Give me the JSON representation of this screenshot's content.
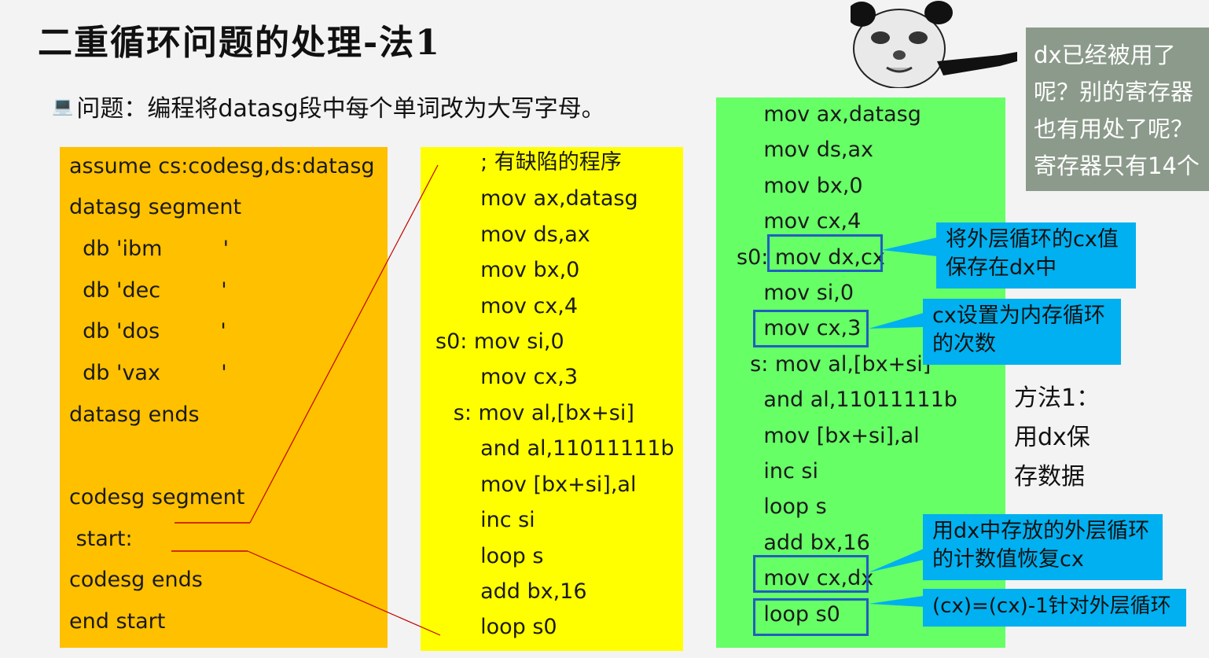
{
  "title": "二重循环问题的处理-法1",
  "problem": {
    "icon": "computer-icon",
    "text": "问题：编程将datasg段中每个单词改为大写字母。"
  },
  "orange_code": [
    "assume cs:codesg,ds:datasg",
    "datasg segment",
    "  db 'ibm         '",
    "  db 'dec         '",
    "  db 'dos         '",
    "  db 'vax         '",
    "datasg ends",
    "",
    "codesg segment",
    " start: ",
    "codesg ends",
    "end start"
  ],
  "yellow_code": [
    "       ; 有缺陷的程序",
    "       mov ax,datasg",
    "       mov ds,ax",
    "       mov bx,0",
    "       mov cx,4",
    "s0: mov si,0",
    "       mov cx,3",
    "   s: mov al,[bx+si]",
    "       and al,11011111b",
    "       mov [bx+si],al",
    "       inc si",
    "       loop s",
    "       add bx,16",
    "       loop s0"
  ],
  "green_code": [
    "    mov ax,datasg",
    "    mov ds,ax",
    "    mov bx,0",
    "    mov cx,4",
    "s0: mov dx,cx",
    "    mov si,0",
    "    mov cx,3",
    "  s: mov al,[bx+si]",
    "    and al,11011111b",
    "    mov [bx+si],al",
    "    inc si",
    "    loop s",
    "    add bx,16",
    "    mov cx,dx",
    "    loop s0"
  ],
  "callouts": {
    "save_cx": "将外层循环的cx值保存在dx中",
    "set_inner": "cx设置为内存循环的次数",
    "restore": "用dx中存放的外层循环的计数值恢复cx",
    "decrement": "(cx)=(cx)-1针对外层循环"
  },
  "method_note": [
    "方法1：",
    "用dx保",
    "存数据"
  ],
  "grey_note": [
    "dx已经被用了",
    "呢？别的寄存器",
    "也有用处了呢？",
    "寄存器只有14个"
  ],
  "meme_icon": "panda-meme-icon"
}
